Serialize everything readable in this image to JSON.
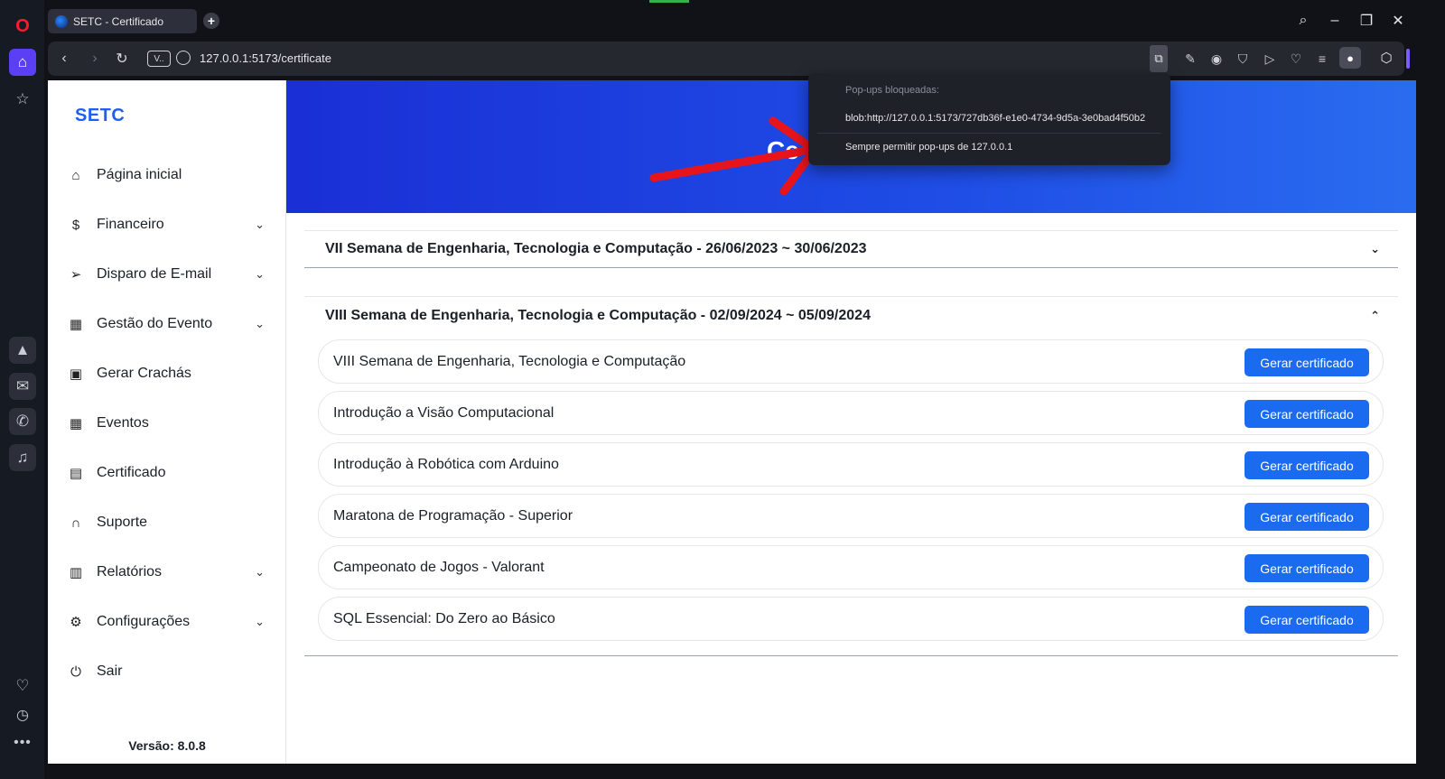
{
  "browser": {
    "tab_title": "SETC - Certificado",
    "url": "127.0.0.1:5173/certificate",
    "vpn_label": "V..",
    "new_tab_label": "+"
  },
  "popup_menu": {
    "header": "Pop-ups bloqueadas:",
    "blocked_url": "blob:http://127.0.0.1:5173/727db36f-e1e0-4734-9d5a-3e0bad4f50b2",
    "allow_label": "Sempre permitir pop-ups de 127.0.0.1"
  },
  "sidebar": {
    "brand": "SETC",
    "items": [
      {
        "label": "Página inicial",
        "icon": "home-icon",
        "expandable": false
      },
      {
        "label": "Financeiro",
        "icon": "dollar-icon",
        "expandable": true
      },
      {
        "label": "Disparo de E-mail",
        "icon": "send-icon",
        "expandable": true
      },
      {
        "label": "Gestão do Evento",
        "icon": "calendar-icon",
        "expandable": true
      },
      {
        "label": "Gerar Crachás",
        "icon": "badge-icon",
        "expandable": false
      },
      {
        "label": "Eventos",
        "icon": "calendar-icon",
        "expandable": false
      },
      {
        "label": "Certificado",
        "icon": "certificate-icon",
        "expandable": false
      },
      {
        "label": "Suporte",
        "icon": "headset-icon",
        "expandable": false
      },
      {
        "label": "Relatórios",
        "icon": "report-icon",
        "expandable": true
      },
      {
        "label": "Configurações",
        "icon": "gear-icon",
        "expandable": true
      },
      {
        "label": "Sair",
        "icon": "power-icon",
        "expandable": false
      }
    ],
    "version": "Versão: 8.0.8"
  },
  "hero": {
    "logo_text": "Ce"
  },
  "events": [
    {
      "title": "VII Semana de Engenharia, Tecnologia e Computação - 26/06/2023 ~ 30/06/2023",
      "expanded": false,
      "items": []
    },
    {
      "title": "VIII Semana de Engenharia, Tecnologia e Computação - 02/09/2024 ~ 05/09/2024",
      "expanded": true,
      "items": [
        {
          "name": "VIII Semana de Engenharia, Tecnologia e Computação",
          "button": "Gerar certificado"
        },
        {
          "name": "Introdução a Visão Computacional",
          "button": "Gerar certificado"
        },
        {
          "name": "Introdução à Robótica com Arduino",
          "button": "Gerar certificado"
        },
        {
          "name": "Maratona de Programação - Superior",
          "button": "Gerar certificado"
        },
        {
          "name": "Campeonato de Jogos - Valorant",
          "button": "Gerar certificado"
        },
        {
          "name": "SQL Essencial: Do Zero ao Básico",
          "button": "Gerar certificado"
        }
      ]
    }
  ],
  "colors": {
    "accent": "#1a6bf0",
    "brand": "#1f5ef0",
    "opera_red": "#ff1b2d",
    "annotation_arrow": "#e8141c"
  }
}
